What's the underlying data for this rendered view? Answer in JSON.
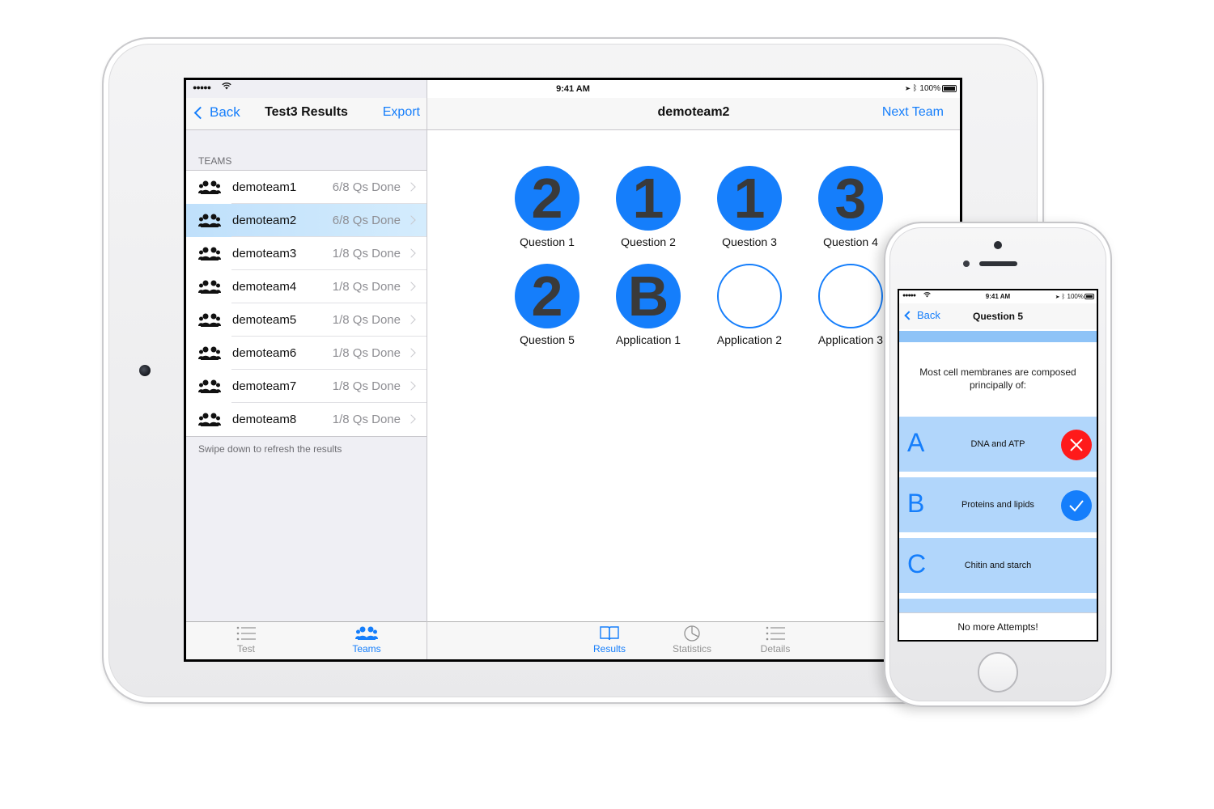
{
  "colors": {
    "accent": "#157efb",
    "wrong": "#ff1a1a",
    "answer_bg": "#b1d6fb"
  },
  "ipad": {
    "status": {
      "time": "9:41 AM",
      "battery": "100%"
    },
    "master": {
      "back_label": "Back",
      "title": "Test3 Results",
      "export_label": "Export",
      "section_header": "TEAMS",
      "teams": [
        {
          "name": "demoteam1",
          "status": "6/8 Qs Done"
        },
        {
          "name": "demoteam2",
          "status": "6/8 Qs Done"
        },
        {
          "name": "demoteam3",
          "status": "1/8 Qs Done"
        },
        {
          "name": "demoteam4",
          "status": "1/8 Qs Done"
        },
        {
          "name": "demoteam5",
          "status": "1/8 Qs Done"
        },
        {
          "name": "demoteam6",
          "status": "1/8 Qs Done"
        },
        {
          "name": "demoteam7",
          "status": "1/8 Qs Done"
        },
        {
          "name": "demoteam8",
          "status": "1/8 Qs Done"
        }
      ],
      "footer_note": "Swipe down to refresh the results",
      "tabs": [
        {
          "label": "Test",
          "icon": "list-icon"
        },
        {
          "label": "Teams",
          "icon": "people-icon"
        }
      ]
    },
    "detail": {
      "title": "demoteam2",
      "next_label": "Next Team",
      "results": [
        {
          "value": "2",
          "label": "Question 1"
        },
        {
          "value": "1",
          "label": "Question 2"
        },
        {
          "value": "1",
          "label": "Question 3"
        },
        {
          "value": "3",
          "label": "Question 4"
        },
        {
          "value": "2",
          "label": "Question 5"
        },
        {
          "value": "B",
          "label": "Application 1"
        },
        {
          "value": "",
          "label": "Application 2"
        },
        {
          "value": "",
          "label": "Application 3"
        }
      ],
      "tabs": [
        {
          "label": "Results",
          "icon": "book-icon"
        },
        {
          "label": "Statistics",
          "icon": "pie-chart-icon"
        },
        {
          "label": "Details",
          "icon": "list-icon"
        }
      ]
    }
  },
  "iphone": {
    "status": {
      "time": "9:41 AM",
      "battery": "100%"
    },
    "back_label": "Back",
    "title": "Question 5",
    "question": "Most cell membranes are composed principally of:",
    "answers": [
      {
        "letter": "A",
        "text": "DNA and ATP",
        "mark": "wrong"
      },
      {
        "letter": "B",
        "text": "Proteins and lipids",
        "mark": "right"
      },
      {
        "letter": "C",
        "text": "Chitin and starch",
        "mark": ""
      }
    ],
    "footer": "No more Attempts!"
  }
}
